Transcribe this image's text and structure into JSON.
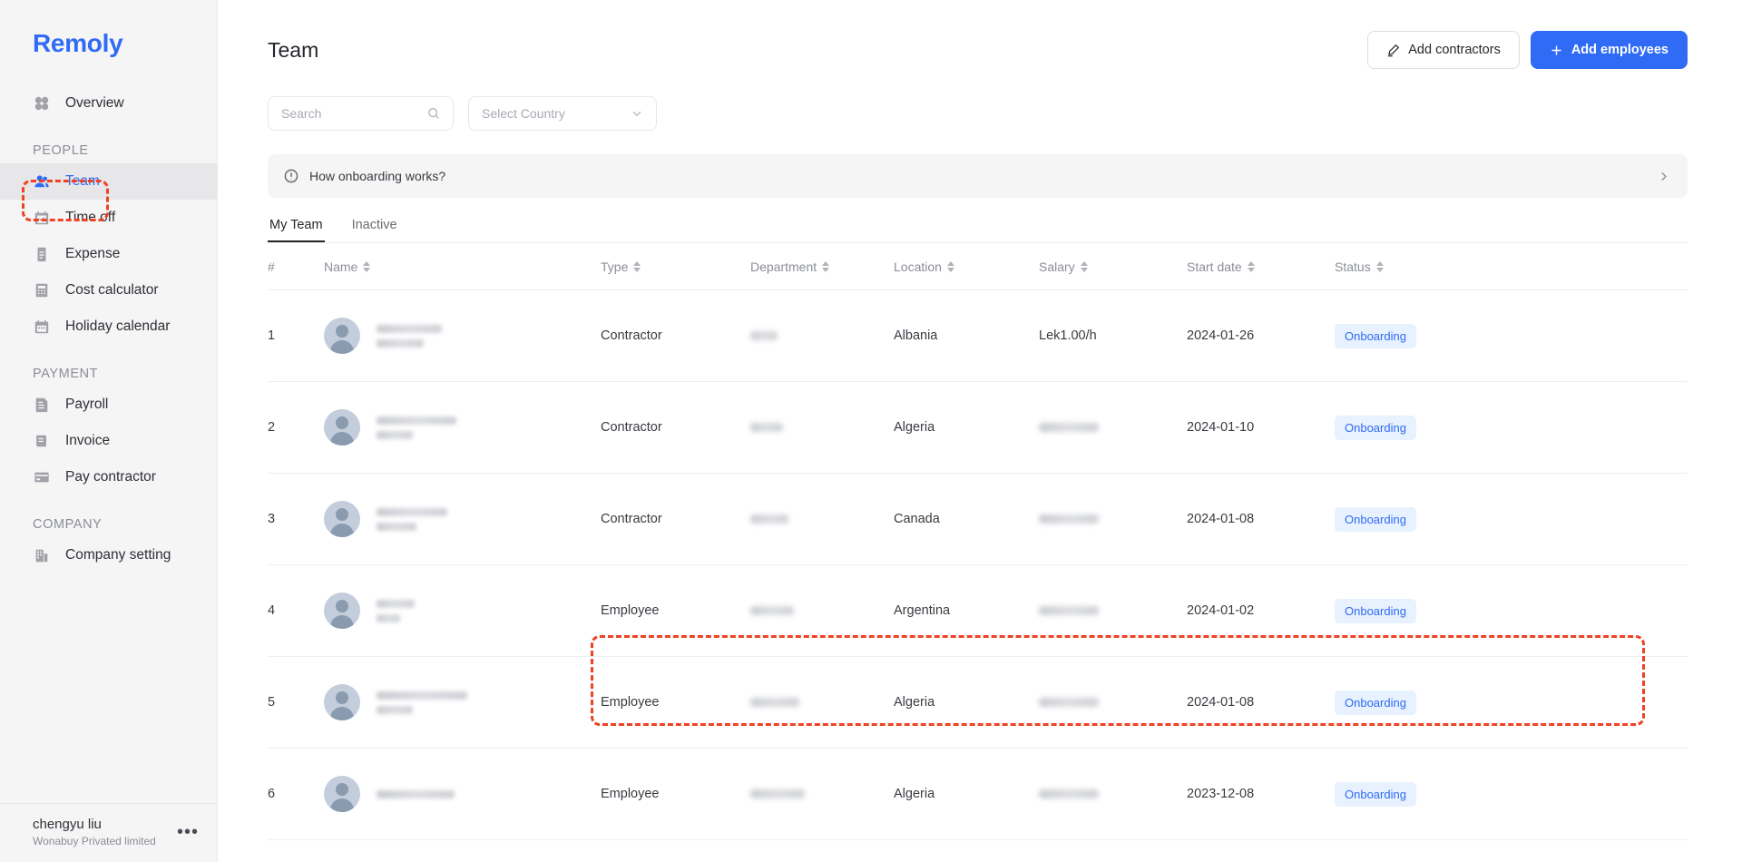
{
  "brand": {
    "name": "Remoly"
  },
  "sidebar": {
    "top_items": [
      {
        "label": "Overview",
        "icon": "grid-icon",
        "active": false
      }
    ],
    "sections": [
      {
        "label": "PEOPLE",
        "items": [
          {
            "label": "Team",
            "icon": "people-icon",
            "active": true
          },
          {
            "label": "Time off",
            "icon": "calendar-check-icon",
            "active": false
          },
          {
            "label": "Expense",
            "icon": "clipboard-icon",
            "active": false
          },
          {
            "label": "Cost calculator",
            "icon": "calculator-icon",
            "active": false
          },
          {
            "label": "Holiday calendar",
            "icon": "calendar-icon",
            "active": false
          }
        ]
      },
      {
        "label": "PAYMENT",
        "items": [
          {
            "label": "Payroll",
            "icon": "document-list-icon",
            "active": false
          },
          {
            "label": "Invoice",
            "icon": "invoice-icon",
            "active": false
          },
          {
            "label": "Pay contractor",
            "icon": "credit-card-icon",
            "active": false
          }
        ]
      },
      {
        "label": "COMPANY",
        "items": [
          {
            "label": "Company setting",
            "icon": "building-icon",
            "active": false
          }
        ]
      }
    ],
    "footer": {
      "user_name": "chengyu liu",
      "company": "Wonabuy Privated limited",
      "more_label": "•••"
    }
  },
  "header": {
    "title": "Team",
    "add_contractors_label": "Add contractors",
    "add_employees_label": "Add employees"
  },
  "filters": {
    "search_placeholder": "Search",
    "search_value": "",
    "country_placeholder": "Select Country",
    "country_value": "Select Country"
  },
  "banner": {
    "text": "How onboarding works?"
  },
  "tabs": [
    {
      "label": "My Team",
      "active": true
    },
    {
      "label": "Inactive",
      "active": false
    }
  ],
  "table": {
    "columns": [
      {
        "key": "num",
        "label": "#",
        "sortable": false
      },
      {
        "key": "name",
        "label": "Name",
        "sortable": true
      },
      {
        "key": "type",
        "label": "Type",
        "sortable": true
      },
      {
        "key": "dept",
        "label": "Department",
        "sortable": true
      },
      {
        "key": "loc",
        "label": "Location",
        "sortable": true
      },
      {
        "key": "sal",
        "label": "Salary",
        "sortable": true
      },
      {
        "key": "start",
        "label": "Start date",
        "sortable": true
      },
      {
        "key": "status",
        "label": "Status",
        "sortable": true
      }
    ],
    "rows": [
      {
        "num": "1",
        "name": "",
        "name_redacted": true,
        "type": "Contractor",
        "dept": "",
        "dept_redacted": true,
        "loc": "Albania",
        "sal": "Lek1.00/h",
        "sal_redacted": false,
        "start": "2024-01-26",
        "status": "Onboarding"
      },
      {
        "num": "2",
        "name": "",
        "name_redacted": true,
        "type": "Contractor",
        "dept": "",
        "dept_redacted": true,
        "loc": "Algeria",
        "sal": "",
        "sal_redacted": true,
        "start": "2024-01-10",
        "status": "Onboarding"
      },
      {
        "num": "3",
        "name": "",
        "name_redacted": true,
        "type": "Contractor",
        "dept": "",
        "dept_redacted": true,
        "loc": "Canada",
        "sal": "",
        "sal_redacted": true,
        "start": "2024-01-08",
        "status": "Onboarding"
      },
      {
        "num": "4",
        "name": "",
        "name_redacted": true,
        "type": "Employee",
        "dept": "",
        "dept_redacted": true,
        "loc": "Argentina",
        "sal": "",
        "sal_redacted": true,
        "start": "2024-01-02",
        "status": "Onboarding"
      },
      {
        "num": "5",
        "name": "",
        "name_redacted": true,
        "type": "Employee",
        "dept": "",
        "dept_redacted": true,
        "loc": "Algeria",
        "sal": "",
        "sal_redacted": true,
        "start": "2024-01-08",
        "status": "Onboarding"
      },
      {
        "num": "6",
        "name": "",
        "name_redacted": true,
        "type": "Employee",
        "dept": "",
        "dept_redacted": true,
        "loc": "Algeria",
        "sal": "",
        "sal_redacted": true,
        "start": "2023-12-08",
        "status": "Onboarding"
      }
    ]
  },
  "annotations": [
    {
      "name": "team-nav-highlight",
      "color": "#ef4123"
    },
    {
      "name": "row-4-highlight",
      "color": "#ef4123"
    }
  ],
  "colors": {
    "brand_blue": "#2f6bf5",
    "sidebar_bg": "#f5f5f6",
    "badge_bg": "#e8f1fe",
    "annotation_red": "#ef4123"
  }
}
